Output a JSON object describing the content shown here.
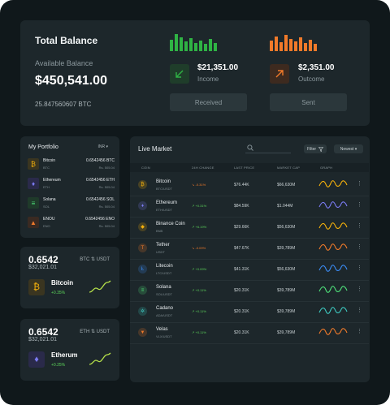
{
  "balance": {
    "title": "Total Balance",
    "available_label": "Available Balance",
    "amount": "$450,541.00",
    "btc": "25.847560607 BTC",
    "income": {
      "value": "$21,351.00",
      "label": "Income",
      "button": "Received",
      "color": "#2fb344"
    },
    "outcome": {
      "value": "$2,351.00",
      "label": "Outcome",
      "button": "Sent",
      "color": "#f07a2a"
    }
  },
  "portfolio": {
    "title": "My Portfolio",
    "select": "INR",
    "items": [
      {
        "name": "Bitcoin",
        "symbol": "BTC",
        "amount": "0.6542456 BTC",
        "fiat": "Rs. 505.04",
        "icon": "bitcoin-icon",
        "bg": "#3a3520",
        "fg": "#f5b10c",
        "glyph": "₿"
      },
      {
        "name": "Ethereum",
        "symbol": "ETH",
        "amount": "0.6542456 ETH",
        "fiat": "Rs. 505.04",
        "icon": "ethereum-icon",
        "bg": "#2a2a4a",
        "fg": "#7b7bf2",
        "glyph": "♦"
      },
      {
        "name": "Solana",
        "symbol": "SOL",
        "amount": "0.6542456 SOL",
        "fiat": "Rs. 505.04",
        "icon": "solana-icon",
        "bg": "#1f3a2a",
        "fg": "#4ee27a",
        "glyph": "≡"
      },
      {
        "name": "ENOU",
        "symbol": "ENO",
        "amount": "0.6542456 ENO",
        "fiat": "Rs. 505.04",
        "icon": "enou-icon",
        "bg": "#3a2a22",
        "fg": "#f07a2a",
        "glyph": "▲"
      }
    ]
  },
  "mini_cards": [
    {
      "price": "0.6542",
      "pair": "BTC ⇅ USDT",
      "usd": "$32,021.01",
      "name": "Bitcoin",
      "change": "+0.35%",
      "icon": "bitcoin-icon",
      "bg": "#3a3520",
      "fg": "#f5b10c",
      "glyph": "₿"
    },
    {
      "price": "0.6542",
      "pair": "ETH ⇅ USDT",
      "usd": "$32,021.01",
      "name": "Etherum",
      "change": "+0.25%",
      "icon": "ethereum-icon",
      "bg": "#2a2a4a",
      "fg": "#7b7bf2",
      "glyph": "♦"
    }
  ],
  "market": {
    "title": "Live Market",
    "filter": "Filter",
    "sort": "Newest",
    "columns": [
      "COIN",
      "24H CHANGE",
      "LAST PRICE",
      "MARKET CAP",
      "GRAPH"
    ],
    "rows": [
      {
        "name": "Bitcoin",
        "pair": "BTC/USDT",
        "change": "-0.31%",
        "dir": "down",
        "price": "$76.44K",
        "cap": "$66,630M",
        "color": "#f5b10c",
        "glyph": "₿"
      },
      {
        "name": "Ethereum",
        "pair": "ETH/USDT",
        "change": "+0.31%",
        "dir": "up",
        "price": "$84.59K",
        "cap": "$1.044M",
        "color": "#7b7bf2",
        "glyph": "♦"
      },
      {
        "name": "Binance Coin",
        "pair": "BNB",
        "change": "+6.19%",
        "dir": "up",
        "price": "$29.66K",
        "cap": "$56,630M",
        "color": "#f5b10c",
        "glyph": "◆"
      },
      {
        "name": "Tether",
        "pair": "USDT",
        "change": "-0.09%",
        "dir": "down",
        "price": "$47.67K",
        "cap": "$39,789M",
        "color": "#f07a2a",
        "glyph": "T"
      },
      {
        "name": "Litecoin",
        "pair": "LTC/USDT",
        "change": "+0.09%",
        "dir": "up",
        "price": "$41.31K",
        "cap": "$56,630M",
        "color": "#3b8cf5",
        "glyph": "Ł"
      },
      {
        "name": "Solana",
        "pair": "SOL/USDT",
        "change": "+0.11%",
        "dir": "up",
        "price": "$20.31K",
        "cap": "$39,789M",
        "color": "#4ee27a",
        "glyph": "≡"
      },
      {
        "name": "Cadano",
        "pair": "ADA/USDT",
        "change": "+0.11%",
        "dir": "up",
        "price": "$20.31K",
        "cap": "$39,789M",
        "color": "#3ec9c0",
        "glyph": "✲"
      },
      {
        "name": "Velas",
        "pair": "VLX/USDT",
        "change": "+0.11%",
        "dir": "up",
        "price": "$20.31K",
        "cap": "$39,789M",
        "color": "#f07a2a",
        "glyph": "▼"
      }
    ]
  }
}
